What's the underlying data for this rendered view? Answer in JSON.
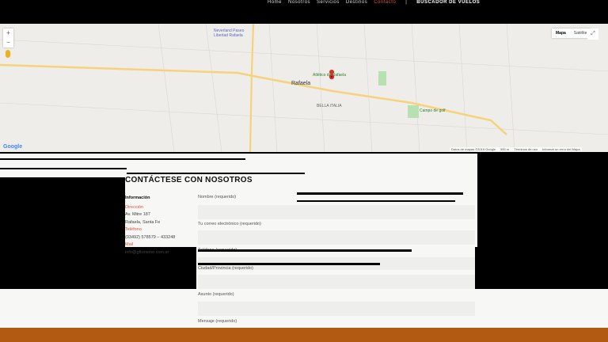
{
  "nav": {
    "items": [
      {
        "label": "Home"
      },
      {
        "label": "Nosotros"
      },
      {
        "label": "Servicios"
      },
      {
        "label": "Destinos"
      },
      {
        "label": "Contacto"
      }
    ],
    "separator": "|",
    "cta": "BUSCADOR DE VUELOS"
  },
  "map": {
    "type_options": [
      "Mapa",
      "Satélite"
    ],
    "zoom_in": "+",
    "zoom_out": "−",
    "fullscreen": "⤢",
    "logo": "Google",
    "labels": {
      "poi1": "Neverland Paseo",
      "poi2": "Libertad Rafaela",
      "city": "Rafaela",
      "club": "Atlético de Rafaela",
      "district": "BELLA ITALIA",
      "golf": "Campo de golf"
    },
    "attribution": [
      "Datos de mapas ©2019 Google",
      "500 m",
      "Términos de uso",
      "Informar un error del Mapa"
    ]
  },
  "contact": {
    "title": "CONTÁCTESE CON NOSOTROS",
    "info": {
      "heading": "Información",
      "address_label": "Dirección",
      "address_line1": "Av. Mitre 187",
      "address_line2": "Rafaela, Santa Fe",
      "phone_label": "Teléfono",
      "phone": "(03492) 578579 – 433248",
      "email_label": "Mail",
      "email": "info@gfturismo.com.ar"
    },
    "form": {
      "name_label": "Nombre (requerido)",
      "email_label": "Tu correo electrónico (requerido)",
      "phone_label": "Teléfono (requerido)",
      "city_label": "Ciudad/Provincia (requerido)",
      "subject_label": "Asunto (requerido)",
      "message_label": "Mensaje (requerido)"
    }
  },
  "colors": {
    "accent": "#d9533f",
    "footer": "#b35a12",
    "map_bg": "#eeedea"
  }
}
